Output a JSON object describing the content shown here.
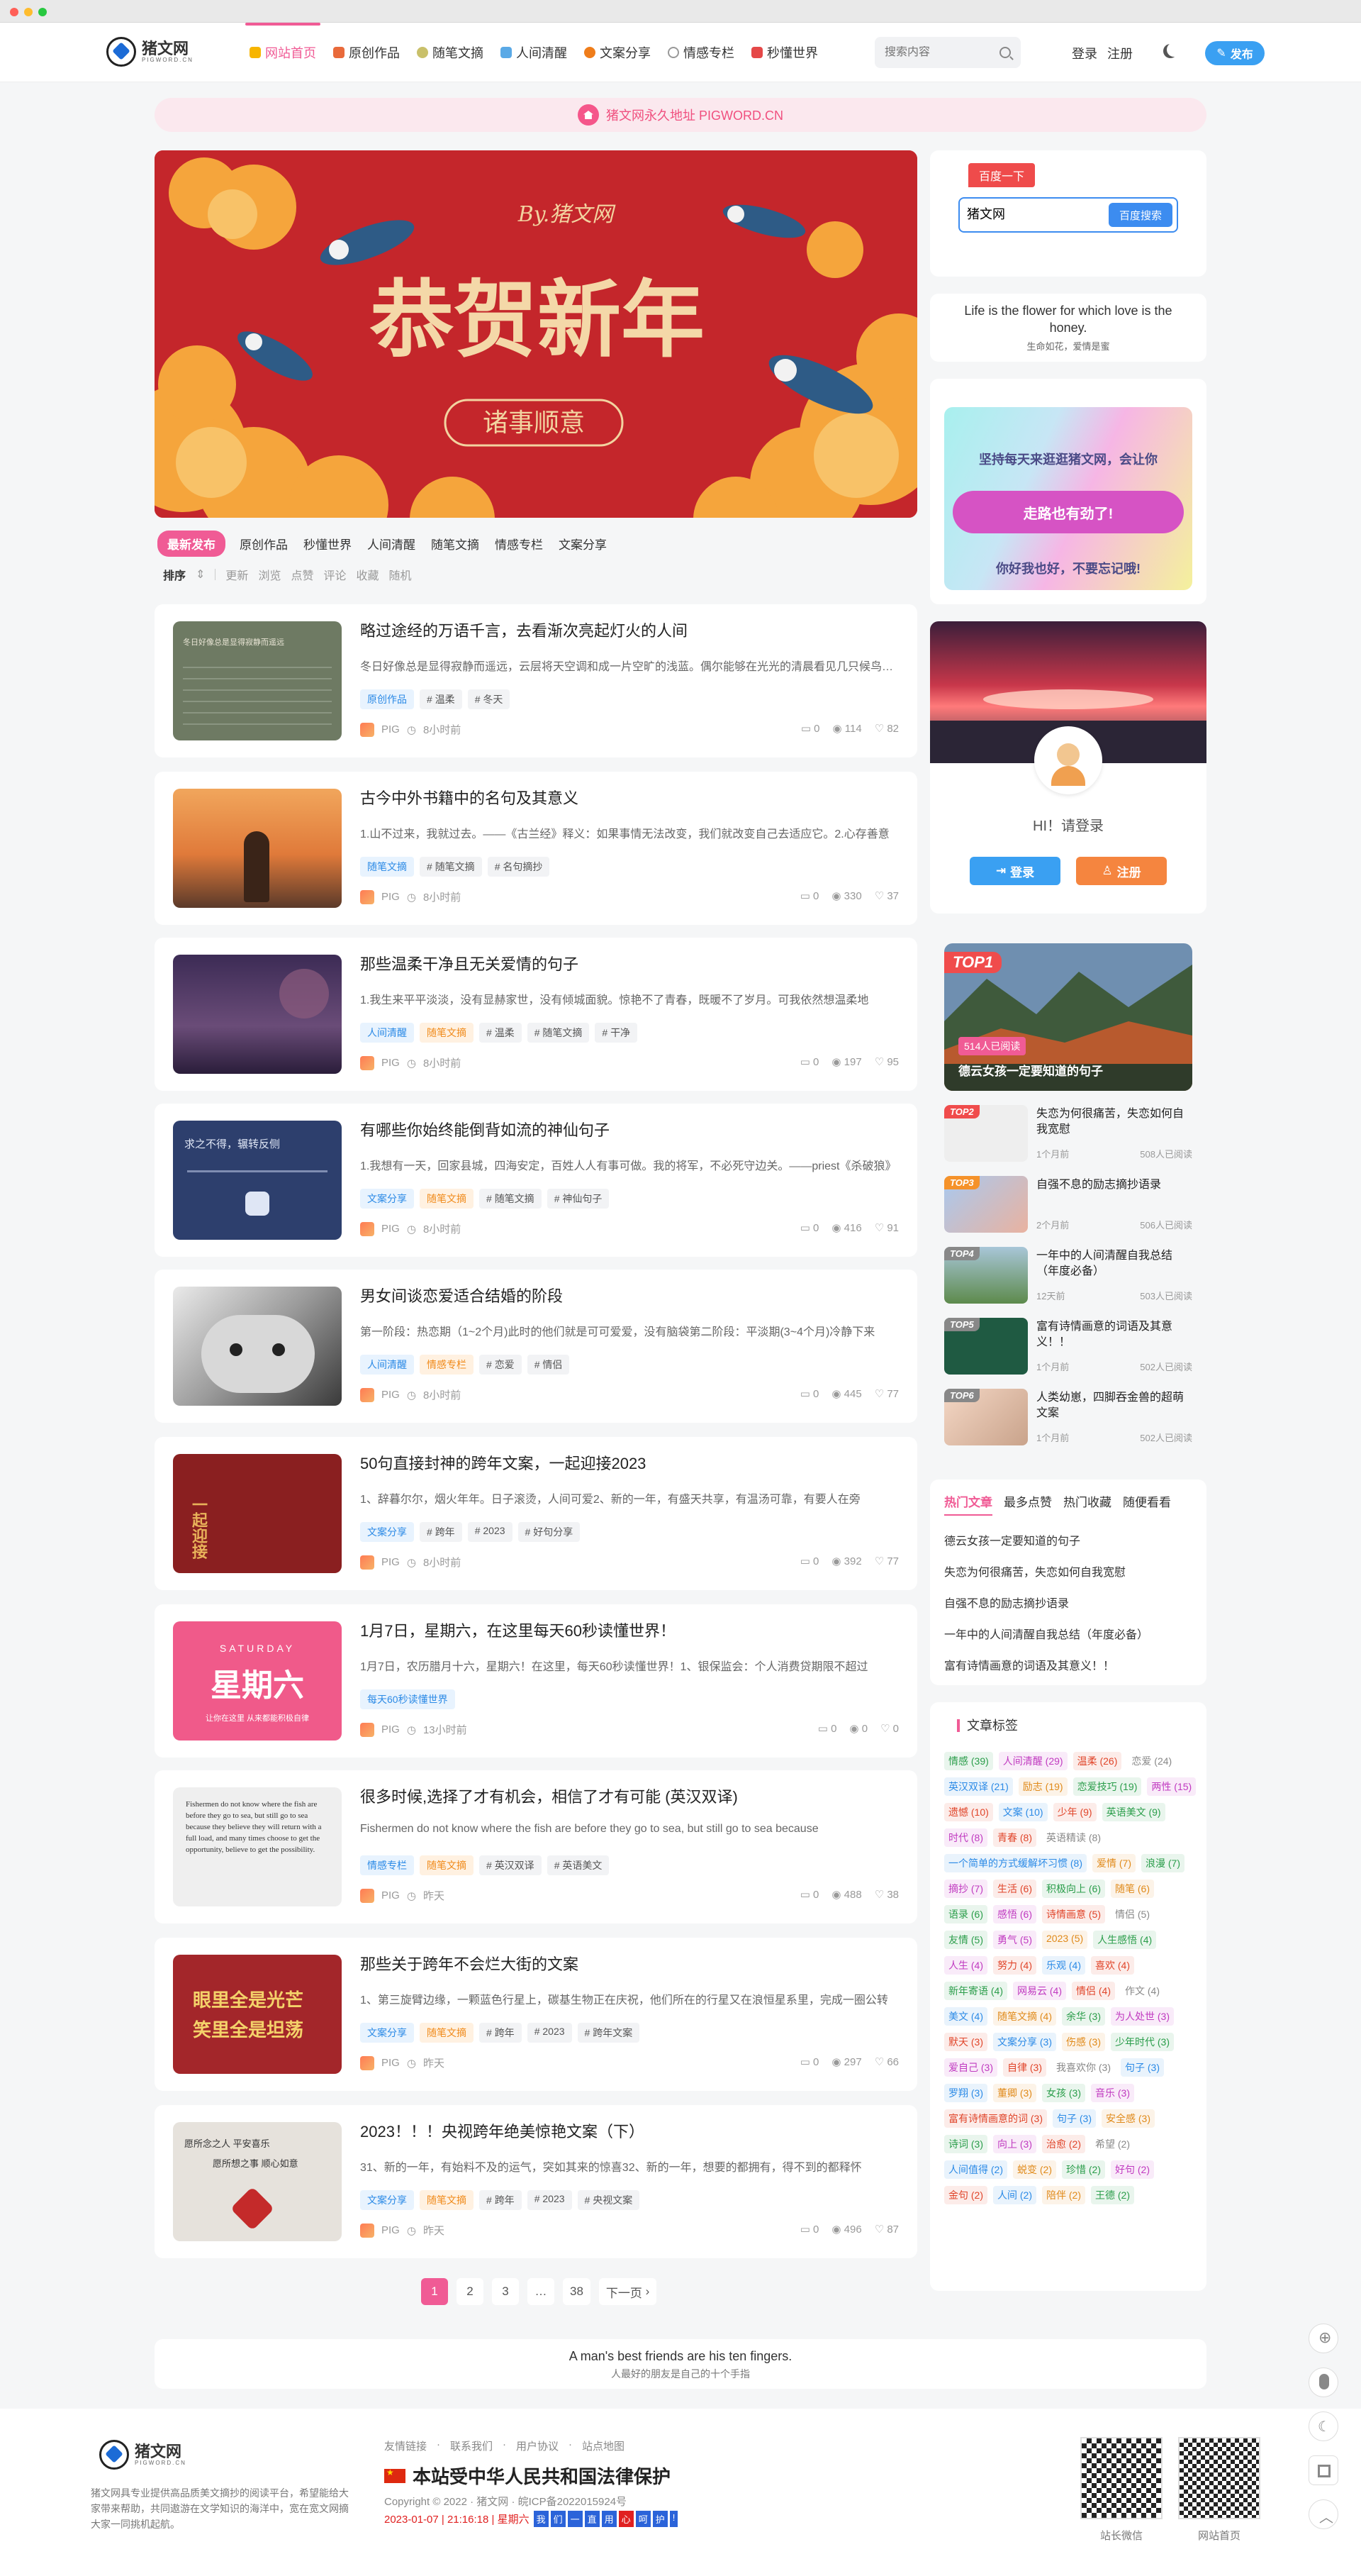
{
  "nav": {
    "items": [
      "网站首页",
      "原创作品",
      "随笔文摘",
      "人间清醒",
      "文案分享",
      "情感专栏",
      "秒懂世界"
    ],
    "search_placeholder": "搜索内容",
    "login": "登录",
    "register": "注册",
    "publish": "发布",
    "accent": "#f05b95"
  },
  "logo": {
    "name": "猪文网",
    "sub": "PIGWORD.CN"
  },
  "notice": "猪文网永久地址 PIGWORD.CN",
  "banner": {
    "by": "By.猪文网",
    "main": "恭贺新年",
    "sub": "诸事顺意"
  },
  "categories": [
    "最新发布",
    "原创作品",
    "秒懂世界",
    "人间清醒",
    "随笔文摘",
    "情感专栏",
    "文案分享"
  ],
  "sorts": [
    "排序",
    "更新",
    "浏览",
    "点赞",
    "评论",
    "收藏",
    "随机"
  ],
  "posts": [
    {
      "title": "略过途经的万语千言，去看渐次亮起灯火的人间",
      "excerpt": "冬日好像总是显得寂静而遥远，云层将天空调和成一片空旷的浅蓝。偶尔能够在光光的清晨看见几只候鸟飞过",
      "tags": [
        "原创作品",
        "温柔",
        "冬天"
      ],
      "author": "PIG",
      "time": "8小时前",
      "comments": "0",
      "views": "114",
      "likes": "82"
    },
    {
      "title": "古今中外书籍中的名句及其意义",
      "excerpt": "1.山不过来，我就过去。——《古兰经》释义：如果事情无法改变，我们就改变自己去适应它。2.心存善意",
      "tags": [
        "随笔文摘",
        "随笔文摘",
        "名句摘抄"
      ],
      "author": "PIG",
      "time": "8小时前",
      "comments": "0",
      "views": "330",
      "likes": "37"
    },
    {
      "title": "那些温柔干净且无关爱情的句子",
      "excerpt": "1.我生来平平淡淡，没有显赫家世，没有倾城面貌。惊艳不了青春，既暖不了岁月。可我依然想温柔地",
      "tags": [
        "人间清醒",
        "随笔文摘",
        "温柔",
        "随笔文摘",
        "干净"
      ],
      "author": "PIG",
      "time": "8小时前",
      "comments": "0",
      "views": "197",
      "likes": "95"
    },
    {
      "title": "有哪些你始终能倒背如流的神仙句子",
      "excerpt": "1.我想有一天，回家县城，四海安定，百姓人人有事可做。我的将军，不必死守边关。——priest《杀破狼》",
      "tags": [
        "文案分享",
        "随笔文摘",
        "随笔文摘",
        "神仙句子"
      ],
      "author": "PIG",
      "time": "8小时前",
      "comments": "0",
      "views": "416",
      "likes": "91"
    },
    {
      "title": "男女间谈恋爱适合结婚的阶段",
      "excerpt": "第一阶段：热恋期（1~2个月)此时的他们就是可可爱爱，没有脑袋第二阶段：平淡期(3~4个月)冷静下来",
      "tags": [
        "人间清醒",
        "情感专栏",
        "恋爱",
        "情侣"
      ],
      "author": "PIG",
      "time": "8小时前",
      "comments": "0",
      "views": "445",
      "likes": "77"
    },
    {
      "title": "50句直接封神的跨年文案，一起迎接2023",
      "excerpt": "1、辞暮尔尔，烟火年年。日子滚烫，人间可爱2、新的一年，有盛天共享，有温汤可靠，有要人在旁",
      "tags": [
        "文案分享",
        "跨年",
        "2023",
        "好句分享"
      ],
      "author": "PIG",
      "time": "8小时前",
      "comments": "0",
      "views": "392",
      "likes": "77"
    },
    {
      "title": "1月7日，星期六，在这里每天60秒读懂世界！",
      "excerpt": "1月7日，农历腊月十六，星期六！在这里，每天60秒读懂世界！1、银保监会：个人消费贷期限不超过",
      "tags": [
        "每天60秒读懂世界"
      ],
      "author": "PIG",
      "time": "13小时前",
      "comments": "0",
      "views": "0",
      "likes": "0"
    },
    {
      "title": "很多时候,选择了才有机会，相信了才有可能 (英汉双译)",
      "excerpt": "Fishermen do not know where the fish are before they go to sea, but still go to sea because",
      "tags": [
        "情感专栏",
        "随笔文摘",
        "英汉双译",
        "英语美文"
      ],
      "author": "PIG",
      "time": "昨天",
      "comments": "0",
      "views": "488",
      "likes": "38"
    },
    {
      "title": "那些关于跨年不会烂大街的文案",
      "excerpt": "1、第三旋臂边缘，一颗蓝色行星上，碳基生物正在庆祝，他们所在的行星又在浪恒星系里，完成一圈公转",
      "tags": [
        "文案分享",
        "随笔文摘",
        "跨年",
        "2023",
        "跨年文案"
      ],
      "author": "PIG",
      "time": "昨天",
      "comments": "0",
      "views": "297",
      "likes": "66"
    },
    {
      "title": "2023！！！央视跨年绝美惊艳文案（下）",
      "excerpt": "31、新的一年，有始料不及的运气，突如其来的惊喜32、新的一年，想要的都拥有，得不到的都释怀",
      "tags": [
        "文案分享",
        "随笔文摘",
        "跨年",
        "2023",
        "央视文案"
      ],
      "author": "PIG",
      "time": "昨天",
      "comments": "0",
      "views": "496",
      "likes": "87"
    }
  ],
  "thumbs": {
    "p1": "冬日好像总是显得寂静而遥远",
    "p4": "求之不得，辗转反侧",
    "p6": "一起迎接",
    "p7_day": "SATURDAY",
    "p7_big": "星期六",
    "p7_sub": "让你在这里 从来都能积极自律",
    "p8": "Fishermen do not know where the fish are before they go to sea, but still go to sea because they believe they will return with a full load, and many times choose to get the opportunity, believe to get the possibility.",
    "p9_1": "眼里全是光芒",
    "p9_2": "笑里全是坦荡",
    "p10_1": "愿所念之人 平安喜乐",
    "p10_2": "愿所想之事 顺心如意"
  },
  "pagination": [
    "1",
    "2",
    "3",
    "…",
    "38",
    "下一页"
  ],
  "baidu": {
    "label": "百度一下",
    "value": "猪文网",
    "button": "百度搜索"
  },
  "quote_side": {
    "en": "Life is the flower for which love is the honey.",
    "zh": "生命如花，爱情是蜜"
  },
  "vip": {
    "top": "坚持每天来逛逛猪文网，会让你",
    "button": "走路也有劲了!",
    "bottom": "你好我也好，不要忘记哦!"
  },
  "login_card": {
    "hi": "HI！请登录",
    "login": "登录",
    "register": "注册"
  },
  "top_posts": {
    "first": {
      "badge": "TOP1",
      "reads": "514人已阅读",
      "title": "德云女孩一定要知道的句子"
    },
    "rest": [
      {
        "badge": "TOP2",
        "title": "失恋为何很痛苦，失恋如何自我宽慰",
        "time": "1个月前",
        "reads": "508人已阅读",
        "color": "#f04c4c"
      },
      {
        "badge": "TOP3",
        "title": "自强不息的励志摘抄语录",
        "time": "2个月前",
        "reads": "506人已阅读",
        "color": "#f5922a"
      },
      {
        "badge": "TOP4",
        "title": "一年中的人间清醒自我总结（年度必备）",
        "time": "12天前",
        "reads": "503人已阅读",
        "color": "#888888"
      },
      {
        "badge": "TOP5",
        "title": "富有诗情画意的词语及其意义！！",
        "time": "1个月前",
        "reads": "502人已阅读",
        "color": "#888888"
      },
      {
        "badge": "TOP6",
        "title": "人类幼崽，四脚吞金兽的超萌文案",
        "time": "1个月前",
        "reads": "502人已阅读",
        "color": "#888888"
      }
    ]
  },
  "hot_tabs": [
    "热门文章",
    "最多点赞",
    "热门收藏",
    "随便看看"
  ],
  "hot_list": [
    "德云女孩一定要知道的句子",
    "失恋为何很痛苦，失恋如何自我宽慰",
    "自强不息的励志摘抄语录",
    "一年中的人间清醒自我总结（年度必备）",
    "富有诗情画意的词语及其意义！！"
  ],
  "tags_title": "文章标签",
  "tag_cloud": [
    {
      "t": "情感 (39)",
      "c": "#2a9d4a"
    },
    {
      "t": "人间清醒 (29)",
      "c": "#c03ac0"
    },
    {
      "t": "温柔 (26)",
      "c": "#e0452a"
    },
    {
      "t": "恋爱 (24)",
      "c": "#888"
    },
    {
      "t": "英汉双译 (21)",
      "c": "#2b8ae6"
    },
    {
      "t": "励志 (19)",
      "c": "#e08a1a"
    },
    {
      "t": "恋爱技巧 (19)",
      "c": "#2a9d4a"
    },
    {
      "t": "两性 (15)",
      "c": "#c03ac0"
    },
    {
      "t": "遗憾 (10)",
      "c": "#e0452a"
    },
    {
      "t": "文案 (10)",
      "c": "#2b8ae6"
    },
    {
      "t": "少年 (9)",
      "c": "#e0452a"
    },
    {
      "t": "英语美文 (9)",
      "c": "#2a9d4a"
    },
    {
      "t": "时代 (8)",
      "c": "#c03ac0"
    },
    {
      "t": "青春 (8)",
      "c": "#e0452a"
    },
    {
      "t": "英语精读 (8)",
      "c": "#888"
    },
    {
      "t": "一个简单的方式缓解坏习惯 (8)",
      "c": "#2b8ae6"
    },
    {
      "t": "爱情 (7)",
      "c": "#e08a1a"
    },
    {
      "t": "浪漫 (7)",
      "c": "#2a9d4a"
    },
    {
      "t": "摘抄 (7)",
      "c": "#c03ac0"
    },
    {
      "t": "生活 (6)",
      "c": "#e0452a"
    },
    {
      "t": "积极向上 (6)",
      "c": "#2a9d4a"
    },
    {
      "t": "随笔 (6)",
      "c": "#e08a1a"
    },
    {
      "t": "语录 (6)",
      "c": "#2a9d4a"
    },
    {
      "t": "感悟 (6)",
      "c": "#c03ac0"
    },
    {
      "t": "诗情画意 (5)",
      "c": "#e0452a"
    },
    {
      "t": "情侣 (5)",
      "c": "#888"
    },
    {
      "t": "友情 (5)",
      "c": "#2a9d4a"
    },
    {
      "t": "勇气 (5)",
      "c": "#c03ac0"
    },
    {
      "t": "2023 (5)",
      "c": "#e08a1a"
    },
    {
      "t": "人生感悟 (4)",
      "c": "#2a9d4a"
    },
    {
      "t": "人生 (4)",
      "c": "#c03ac0"
    },
    {
      "t": "努力 (4)",
      "c": "#e0452a"
    },
    {
      "t": "乐观 (4)",
      "c": "#2b8ae6"
    },
    {
      "t": "喜欢 (4)",
      "c": "#e0452a"
    },
    {
      "t": "新年寄语 (4)",
      "c": "#2a9d4a"
    },
    {
      "t": "网易云 (4)",
      "c": "#c03ac0"
    },
    {
      "t": "情侣 (4)",
      "c": "#e0452a"
    },
    {
      "t": "作文 (4)",
      "c": "#888"
    },
    {
      "t": "美文 (4)",
      "c": "#2b8ae6"
    },
    {
      "t": "随笔文摘 (4)",
      "c": "#e08a1a"
    },
    {
      "t": "余华 (3)",
      "c": "#2a9d4a"
    },
    {
      "t": "为人处世 (3)",
      "c": "#c03ac0"
    },
    {
      "t": "默天 (3)",
      "c": "#e0452a"
    },
    {
      "t": "文案分享 (3)",
      "c": "#2b8ae6"
    },
    {
      "t": "伤感 (3)",
      "c": "#e08a1a"
    },
    {
      "t": "少年时代 (3)",
      "c": "#2a9d4a"
    },
    {
      "t": "爱自己 (3)",
      "c": "#c03ac0"
    },
    {
      "t": "自律 (3)",
      "c": "#e0452a"
    },
    {
      "t": "我喜欢你 (3)",
      "c": "#888"
    },
    {
      "t": "句子 (3)",
      "c": "#2b8ae6"
    },
    {
      "t": "罗翔 (3)",
      "c": "#2b8ae6"
    },
    {
      "t": "董卿 (3)",
      "c": "#e08a1a"
    },
    {
      "t": "女孩 (3)",
      "c": "#2a9d4a"
    },
    {
      "t": "音乐 (3)",
      "c": "#c03ac0"
    },
    {
      "t": "富有诗情画意的词 (3)",
      "c": "#e0452a"
    },
    {
      "t": "句子 (3)",
      "c": "#2b8ae6"
    },
    {
      "t": "安全感 (3)",
      "c": "#e08a1a"
    },
    {
      "t": "诗词 (3)",
      "c": "#2a9d4a"
    },
    {
      "t": "向上 (3)",
      "c": "#c03ac0"
    },
    {
      "t": "治愈 (2)",
      "c": "#e0452a"
    },
    {
      "t": "希望 (2)",
      "c": "#888"
    },
    {
      "t": "人间值得 (2)",
      "c": "#2b8ae6"
    },
    {
      "t": "蜕变 (2)",
      "c": "#e08a1a"
    },
    {
      "t": "珍惜 (2)",
      "c": "#2a9d4a"
    },
    {
      "t": "好句 (2)",
      "c": "#c03ac0"
    },
    {
      "t": "金句 (2)",
      "c": "#e0452a"
    },
    {
      "t": "人间 (2)",
      "c": "#2b8ae6"
    },
    {
      "t": "陪伴 (2)",
      "c": "#e08a1a"
    },
    {
      "t": "王德 (2)",
      "c": "#2a9d4a"
    }
  ],
  "bottom_quote": {
    "en": "A man's best friends are his ten fingers.",
    "zh": "人最好的朋友是自己的十个手指"
  },
  "footer": {
    "logo": "猪文网",
    "logo_sub": "PIGWORD.CN",
    "desc": "猪文网具专业提供高品质美文摘抄的阅读平台，希望能给大家带来帮助，共同遨游在文学知识的海洋中，宽在宽文网摘大家一同挑机起航。",
    "links": [
      "友情链接",
      "联系我们",
      "用户协议",
      "站点地图"
    ],
    "law": "本站受中华人民共和国法律保护",
    "copyright": "Copyright © 2022 · 猪文网 · 皖ICP备2022015924号",
    "time": "2023-01-07 | 21:16:18 | 星期六",
    "blocks": [
      "我",
      "们",
      "一",
      "直",
      "用",
      "心",
      "呵",
      "护",
      "!"
    ],
    "qr1": "站长微信",
    "qr2": "网站首页"
  }
}
